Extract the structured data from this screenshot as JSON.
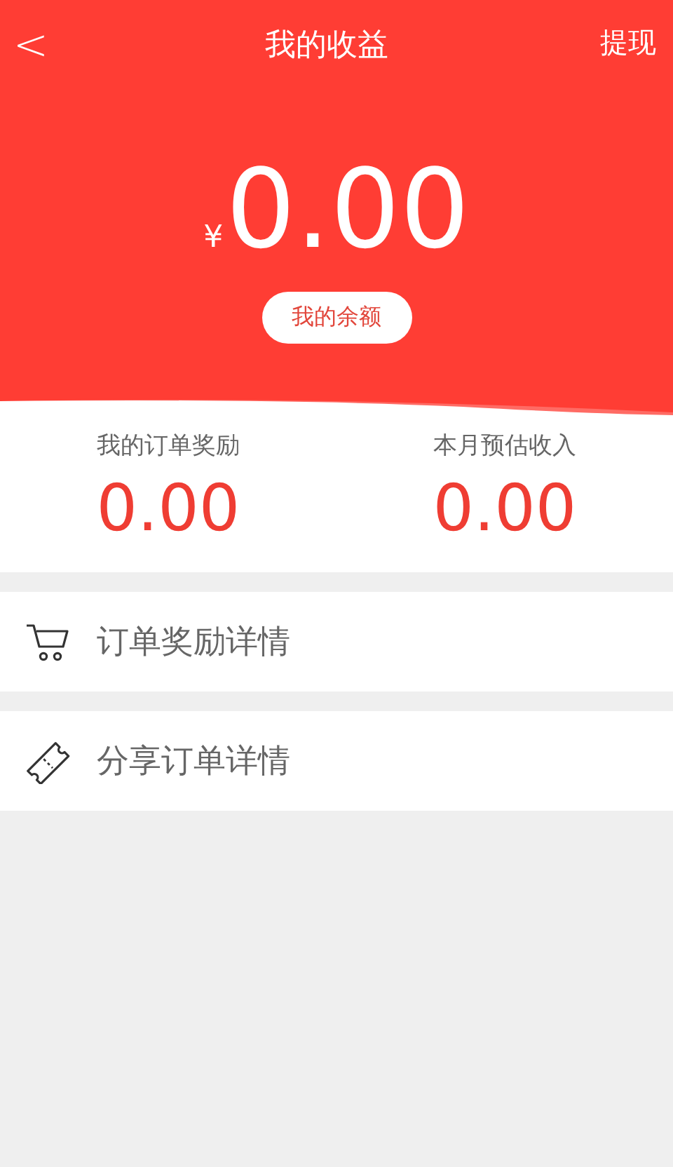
{
  "nav": {
    "back": "<",
    "title": "我的收益",
    "action": "提现"
  },
  "balance": {
    "currency": "¥",
    "amount": "0.00",
    "button": "我的余额"
  },
  "stats": [
    {
      "label": "我的订单奖励",
      "value": "0.00"
    },
    {
      "label": "本月预估收入",
      "value": "0.00"
    }
  ],
  "menu": [
    {
      "kind": "cart",
      "label": "订单奖励详情"
    },
    {
      "kind": "ticket",
      "label": "分享订单详情"
    }
  ]
}
